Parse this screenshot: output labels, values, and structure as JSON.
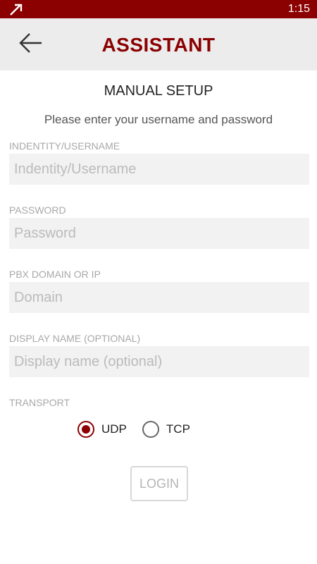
{
  "status_bar": {
    "time": "1:15",
    "icons": [
      "signal-icon"
    ]
  },
  "app_bar": {
    "title": "ASSISTANT",
    "back_icon": "arrow-left-icon"
  },
  "form": {
    "heading": "MANUAL SETUP",
    "instructions": "Please enter your username and password",
    "fields": [
      {
        "label": "INDENTITY/USERNAME",
        "placeholder": "Indentity/Username",
        "value": ""
      },
      {
        "label": "PASSWORD",
        "placeholder": "Password",
        "value": ""
      },
      {
        "label": "PBX DOMAIN OR IP",
        "placeholder": "Domain",
        "value": ""
      },
      {
        "label": "DISPLAY NAME (OPTIONAL)",
        "placeholder": "Display name (optional)",
        "value": ""
      }
    ],
    "transport": {
      "label": "TRANSPORT",
      "options": [
        {
          "label": "UDP",
          "selected": true
        },
        {
          "label": "TCP",
          "selected": false
        }
      ]
    },
    "login_label": "LOGIN"
  },
  "colors": {
    "accent": "#8b0000",
    "app_bar_bg": "#ececec",
    "field_bg": "#f2f2f2",
    "label_text": "#a8a8a8",
    "disabled_text": "#b5b5b5"
  }
}
